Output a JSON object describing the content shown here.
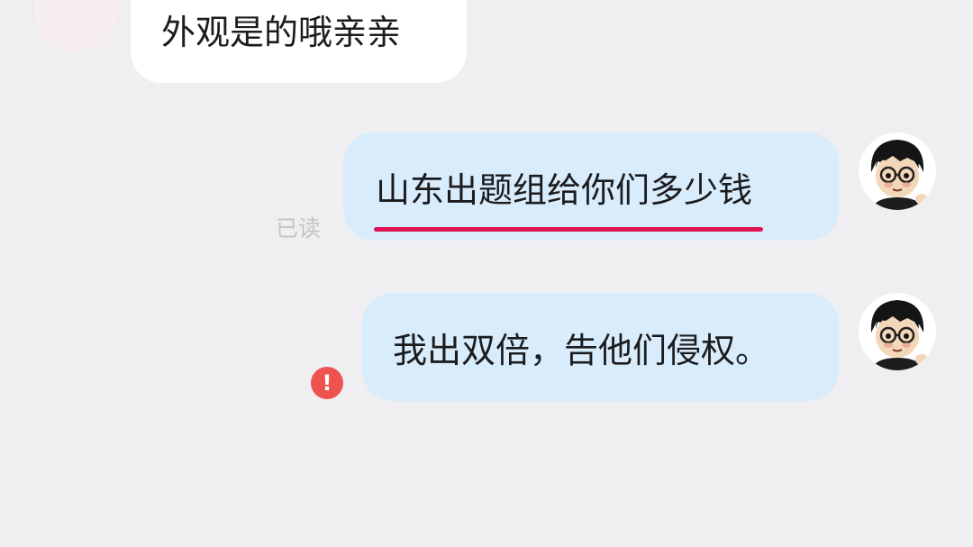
{
  "chat": {
    "messages": [
      {
        "direction": "incoming",
        "text": "外观是的哦亲亲"
      },
      {
        "direction": "outgoing",
        "text": "山东出题组给你们多少钱",
        "status_text": "已读",
        "highlighted": true
      },
      {
        "direction": "outgoing",
        "text": "我出双倍，告他们侵权。",
        "status": "failed",
        "status_icon": "error-icon"
      }
    ]
  },
  "colors": {
    "background": "#efeff1",
    "incoming_bubble": "#ffffff",
    "outgoing_bubble": "#d8ecfb",
    "underline": "#e01455",
    "error": "#ef5350",
    "read_receipt": "#c4c4c8"
  },
  "icons": {
    "self_avatar": "cartoon-boy-glasses-avatar",
    "other_avatar": "shop-avatar"
  }
}
